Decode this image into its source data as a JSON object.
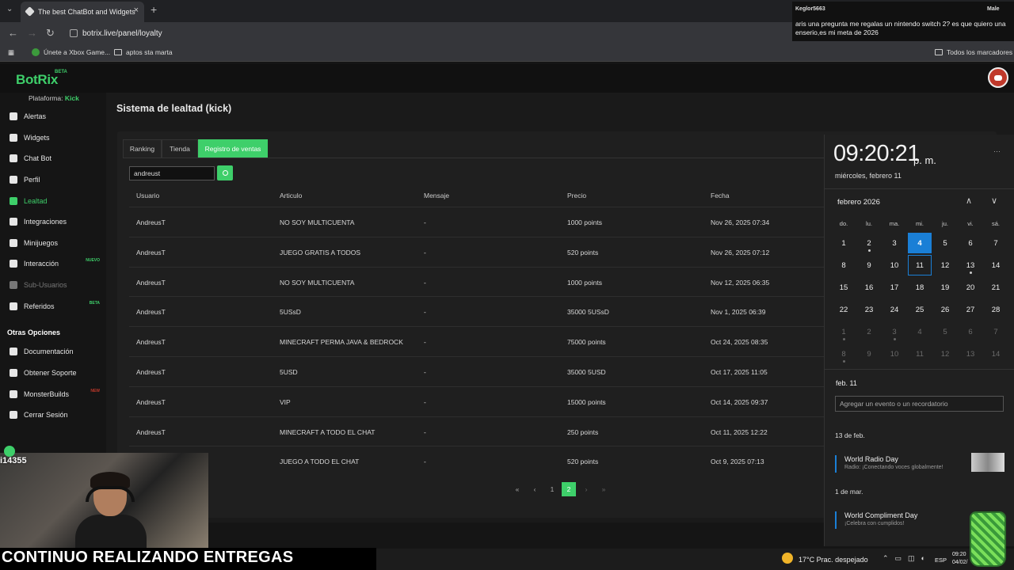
{
  "browser": {
    "tab_title": "The best ChatBot and Widgets",
    "url": "botrix.live/panel/loyalty",
    "bookmarks": [
      "Únete a Xbox Game...",
      "aptos sta marta"
    ],
    "bookmarks_right": "Todos los marcadores"
  },
  "notification": {
    "user": "Keglor5663",
    "gender": "Male",
    "message": "aris una pregunta me regalas un nintendo switch 2? es que quiero una enserio,es mi meta de 2026"
  },
  "app": {
    "logo": "BotRix",
    "beta": "BETA",
    "platform_label": "Plataforma:",
    "platform_value": "Kick"
  },
  "sidebar": {
    "items": [
      {
        "label": "Alertas",
        "icon": "warning-icon"
      },
      {
        "label": "Widgets",
        "icon": "grid-icon"
      },
      {
        "label": "Chat Bot",
        "icon": "chat-icon"
      },
      {
        "label": "Perfil",
        "icon": "profile-icon"
      },
      {
        "label": "Lealtad",
        "icon": "trophy-icon"
      },
      {
        "label": "Integraciones",
        "icon": "plug-icon"
      },
      {
        "label": "Minijuegos",
        "icon": "gamepad-icon"
      },
      {
        "label": "Interacción",
        "icon": "music-icon",
        "tag": "NUEVO"
      },
      {
        "label": "Sub-Usuarios",
        "icon": "users-icon"
      },
      {
        "label": "Referidos",
        "icon": "referral-icon",
        "tag": "BETA"
      }
    ],
    "other_heading": "Otras Opciones",
    "other_items": [
      {
        "label": "Documentación",
        "icon": "book-icon"
      },
      {
        "label": "Obtener Soporte",
        "icon": "help-icon"
      },
      {
        "label": "MonsterBuilds",
        "icon": "monitor-icon",
        "tag": "NEW"
      },
      {
        "label": "Cerrar Sesión",
        "icon": "logout-icon"
      }
    ]
  },
  "main": {
    "title": "Sistema de lealtad (kick)",
    "tabs": [
      "Ranking",
      "Tienda",
      "Registro de ventas"
    ],
    "search_value": "andreust",
    "columns": [
      "Usuario",
      "Articulo",
      "Mensaje",
      "Precio",
      "Fecha"
    ],
    "rows": [
      [
        "AndreusT",
        "NO SOY MULTICUENTA",
        "-",
        "1000 points",
        "Nov 26, 2025 07:34"
      ],
      [
        "AndreusT",
        "JUEGO GRATIS A TODOS",
        "-",
        "520 points",
        "Nov 26, 2025 07:12"
      ],
      [
        "AndreusT",
        "NO SOY MULTICUENTA",
        "-",
        "1000 points",
        "Nov 12, 2025 06:35"
      ],
      [
        "AndreusT",
        "5USsD",
        "-",
        "35000 5USsD",
        "Nov 1, 2025 06:39"
      ],
      [
        "AndreusT",
        "MINECRAFT PERMA JAVA & BEDROCK",
        "-",
        "75000 points",
        "Oct 24, 2025 08:35"
      ],
      [
        "AndreusT",
        "5USD",
        "-",
        "35000 5USD",
        "Oct 17, 2025 11:05"
      ],
      [
        "AndreusT",
        "VIP",
        "-",
        "15000 points",
        "Oct 14, 2025 09:37"
      ],
      [
        "AndreusT",
        "MINECRAFT A TODO EL CHAT",
        "-",
        "250 points",
        "Oct 11, 2025 12:22"
      ],
      [
        "AndreusT",
        "JUEGO A TODO EL CHAT",
        "-",
        "520 points",
        "Oct 9, 2025 07:13"
      ]
    ],
    "pagination": [
      "«",
      "‹",
      "1",
      "2",
      "›",
      "»"
    ]
  },
  "calendar": {
    "time": "09:20:21",
    "ampm": "p. m.",
    "date_long": "miércoles, febrero 11",
    "month": "febrero 2026",
    "weekdays": [
      "do.",
      "lu.",
      "ma.",
      "mi.",
      "ju.",
      "vi.",
      "sá."
    ],
    "weeks": [
      [
        "1",
        "2",
        "3",
        "4",
        "5",
        "6",
        "7"
      ],
      [
        "8",
        "9",
        "10",
        "11",
        "12",
        "13",
        "14"
      ],
      [
        "15",
        "16",
        "17",
        "18",
        "19",
        "20",
        "21"
      ],
      [
        "22",
        "23",
        "24",
        "25",
        "26",
        "27",
        "28"
      ],
      [
        "1",
        "2",
        "3",
        "4",
        "5",
        "6",
        "7"
      ],
      [
        "8",
        "9",
        "10",
        "11",
        "12",
        "13",
        "14"
      ]
    ],
    "selected_short": "feb. 11",
    "add_event_placeholder": "Agregar un evento o un recordatorio",
    "events": [
      {
        "date": "13 de feb.",
        "title": "World Radio Day",
        "subtitle": "Radio: ¡Conectando voces globalmente!"
      },
      {
        "date": "1 de mar.",
        "title": "World Compliment Day",
        "subtitle": "¡Celebra con cumplidos!"
      }
    ]
  },
  "taskbar": {
    "weather": "17°C  Prac. despejado",
    "lang": "ESP",
    "time": "09:20",
    "date": "04/02/"
  },
  "stream": {
    "handle": "i14355",
    "banner": "CONTINUO REALIZANDO ENTREGAS"
  }
}
